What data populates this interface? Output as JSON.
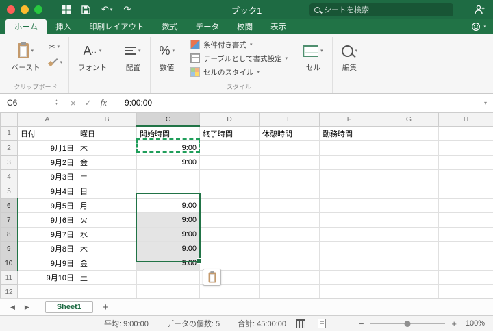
{
  "titlebar": {
    "title": "ブック1",
    "search_placeholder": "シートを検索"
  },
  "ribbon": {
    "tabs": [
      "ホーム",
      "挿入",
      "印刷レイアウト",
      "数式",
      "データ",
      "校閲",
      "表示"
    ],
    "active_tab": "ホーム",
    "paste_label": "ペースト",
    "clipboard_group_label": "クリップボード",
    "font_label": "フォント",
    "alignment_label": "配置",
    "number_label": "数値",
    "conditional_formatting_label": "条件付き書式",
    "format_as_table_label": "テーブルとして書式設定",
    "cell_styles_label": "セルのスタイル",
    "styles_group_label": "スタイル",
    "cells_label": "セル",
    "editing_label": "編集"
  },
  "formula_bar": {
    "name_box": "C6",
    "value": "9:00:00"
  },
  "grid": {
    "column_headers": [
      "A",
      "B",
      "C",
      "D",
      "E",
      "F",
      "G",
      "H"
    ],
    "rows": [
      {
        "n": "1",
        "cells": {
          "A": "日付",
          "B": "曜日",
          "C": "開始時間",
          "D": "終了時間",
          "E": "休憩時間",
          "F": "勤務時間"
        }
      },
      {
        "n": "2",
        "cells": {
          "A": "9月1日",
          "B": "木",
          "C": "9:00"
        }
      },
      {
        "n": "3",
        "cells": {
          "A": "9月2日",
          "B": "金",
          "C": "9:00"
        }
      },
      {
        "n": "4",
        "cells": {
          "A": "9月3日",
          "B": "土"
        }
      },
      {
        "n": "5",
        "cells": {
          "A": "9月4日",
          "B": "日"
        }
      },
      {
        "n": "6",
        "cells": {
          "A": "9月5日",
          "B": "月",
          "C": "9:00"
        }
      },
      {
        "n": "7",
        "cells": {
          "A": "9月6日",
          "B": "火",
          "C": "9:00"
        }
      },
      {
        "n": "8",
        "cells": {
          "A": "9月7日",
          "B": "水",
          "C": "9:00"
        }
      },
      {
        "n": "9",
        "cells": {
          "A": "9月8日",
          "B": "木",
          "C": "9:00"
        }
      },
      {
        "n": "10",
        "cells": {
          "A": "9月9日",
          "B": "金",
          "C": "9:00"
        }
      },
      {
        "n": "11",
        "cells": {
          "A": "9月10日",
          "B": "土"
        }
      },
      {
        "n": "12",
        "cells": {}
      }
    ]
  },
  "selection": {
    "active_cell": "C6",
    "column": "C",
    "rows_start": 6,
    "rows_end": 10,
    "copied_cell": "C2"
  },
  "sheet_bar": {
    "active_sheet": "Sheet1"
  },
  "status_bar": {
    "average": "平均: 9:00:00",
    "count": "データの個数: 5",
    "sum": "合計: 45:00:00",
    "zoom_level": "100%"
  },
  "icons": {
    "caret": "▾",
    "scissors": "✂",
    "undo": "↶",
    "redo": "↷",
    "check": "✓",
    "cross": "×",
    "fx": "fx",
    "smiley": "☺",
    "prev": "◀",
    "next": "▶",
    "add": "+",
    "minus": "−",
    "plus": "+",
    "percent": "%",
    "font_a": "A",
    "font_dots": "..",
    "stepper_up": "▲",
    "stepper_down": "▼"
  }
}
